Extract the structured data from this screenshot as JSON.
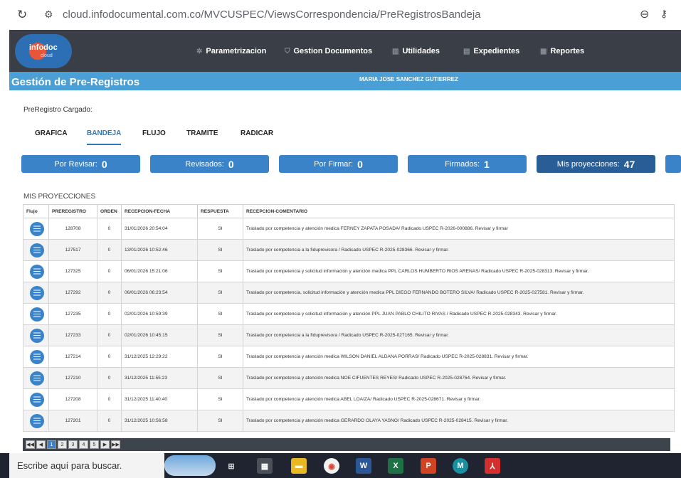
{
  "browser": {
    "url": "cloud.infodocumental.com.co/MVCUSPEC/ViewsCorrespondencia/PreRegistrosBandeja",
    "reload_icon": "reload-icon",
    "site_info_icon": "site-settings-icon",
    "zoom_icon": "zoom-icon",
    "password_icon": "key-icon"
  },
  "header": {
    "logo_text": "infodoc",
    "logo_sub": "cloud",
    "nav": [
      {
        "label": "Parametrizacion",
        "icon": "gear-icon"
      },
      {
        "label": "Gestion Documentos",
        "icon": "shield-icon"
      },
      {
        "label": "Utilidades",
        "icon": "chart-icon"
      },
      {
        "label": "Expedientes",
        "icon": "folder-icon"
      },
      {
        "label": "Reportes",
        "icon": "report-icon"
      }
    ]
  },
  "title_band": {
    "title": "Gestión de Pre-Registros",
    "user": "MARIA JOSE SANCHEZ GUTIERREZ"
  },
  "content": {
    "loaded_label": "PreRegistro Cargado:",
    "tabs": [
      "GRAFICA",
      "BANDEJA",
      "FLUJO",
      "TRAMITE",
      "RADICAR"
    ],
    "active_tab": "BANDEJA",
    "counters": [
      {
        "label": "Por Revisar:",
        "value": "0"
      },
      {
        "label": "Revisados:",
        "value": "0"
      },
      {
        "label": "Por Firmar:",
        "value": "0"
      },
      {
        "label": "Firmados:",
        "value": "1"
      },
      {
        "label": "Mis proyecciones:",
        "value": "47"
      }
    ],
    "section_label": "MIS PROYECCIONES",
    "columns": [
      "Flujo",
      "PREREGISTRO",
      "ORDEN",
      "RECEPCION-FECHA",
      "RESPUESTA",
      "RECEPCION-COMENTARIO"
    ],
    "rows": [
      {
        "preregistro": "128708",
        "orden": "0",
        "fecha": "31/01/2026 20:54:04",
        "respuesta": "SI",
        "comentario": "Traslado por competencia y atención medica FERNEY ZAPATA POSADA/ Radicado USPEC R-2026-000886. Revisar y firmar"
      },
      {
        "preregistro": "127517",
        "orden": "0",
        "fecha": "13/01/2026 10:52:46",
        "respuesta": "SI",
        "comentario": "Traslado por competencia a la fiduprevisora / Radicado USPEC R-2025-028366. Revisar y firmar."
      },
      {
        "preregistro": "127325",
        "orden": "0",
        "fecha": "06/01/2026 15:21:06",
        "respuesta": "SI",
        "comentario": "Traslado por competencia y solicitud información y atención medica PPL CARLOS HUMBERTO RIOS ARENAS/ Radicado USPEC R-2025-028313. Revisar y firmar."
      },
      {
        "preregistro": "127292",
        "orden": "0",
        "fecha": "06/01/2026 06:23:54",
        "respuesta": "SI",
        "comentario": "Traslado por competencia, solicitud información y atención medica PPL DIEGO FERNANDO BOTERO SILVA/ Radicado USPEC R-2025-027581. Revisar y firmar."
      },
      {
        "preregistro": "127235",
        "orden": "0",
        "fecha": "02/01/2026 10:59:39",
        "respuesta": "SI",
        "comentario": "Traslado por competencia y solicitud información y atención PPL JUAN PABLO CHILITO RIVAS / Radicado USPEC R-2025-028343. Revisar y firmar."
      },
      {
        "preregistro": "127233",
        "orden": "0",
        "fecha": "02/01/2026 10:45:15",
        "respuesta": "SI",
        "comentario": "Traslado por competencia a la fiduprevisora / Radicado USPEC R-2025-027165. Revisar y firmar."
      },
      {
        "preregistro": "127214",
        "orden": "0",
        "fecha": "31/12/2025 12:29:22",
        "respuesta": "SI",
        "comentario": "Traslado por competencia y atención medica WILSON DANIEL ALDANA PORRAS/ Radicado USPEC R-2025-028831. Revisar y firmar."
      },
      {
        "preregistro": "127210",
        "orden": "0",
        "fecha": "31/12/2025 11:55:23",
        "respuesta": "SI",
        "comentario": "Traslado por competencia y atención medica NOE CIFUENTES REYES/ Radicado USPEC R-2025-028764. Revisar y firmar."
      },
      {
        "preregistro": "127208",
        "orden": "0",
        "fecha": "31/12/2025 11:40:40",
        "respuesta": "SI",
        "comentario": "Traslado por competencia y atención medica ABEL LOAIZA/ Radicado USPEC R-2025-028671. Revisar y firmar."
      },
      {
        "preregistro": "127201",
        "orden": "0",
        "fecha": "31/12/2025 10:56:58",
        "respuesta": "SI",
        "comentario": "Traslado por competencia y atención medica GERARDO OLAYA YASNO/ Radicado USPEC R-2025-028415. Revisar y firmar."
      }
    ],
    "pager": {
      "first": "◀◀",
      "prev": "◀",
      "pages": [
        "1",
        "2",
        "3",
        "4",
        "5"
      ],
      "active_page": "1",
      "next": "▶",
      "last": "▶▶"
    }
  },
  "taskbar": {
    "search_placeholder": "Escribe aquí para buscar.",
    "icons": [
      "task-view-icon",
      "calculator-icon",
      "file-explorer-icon",
      "chrome-icon",
      "word-icon",
      "excel-icon",
      "powerpoint-icon",
      "chrome-profile-icon",
      "pdf-icon"
    ]
  }
}
